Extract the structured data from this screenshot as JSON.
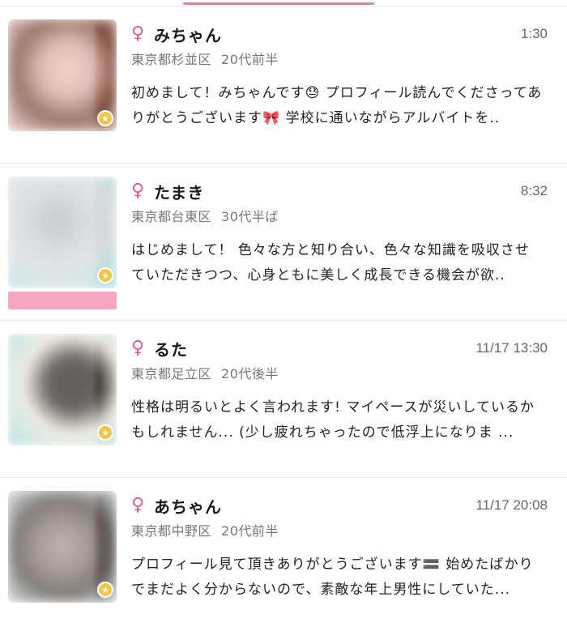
{
  "icons": {
    "gender": "female-icon",
    "badge": "star-badge-icon"
  },
  "colors": {
    "accent": "#f07aa0",
    "female": "#e85a8a",
    "badge": "#f4c542"
  },
  "users": [
    {
      "name": "みちゃん",
      "time": "1:30",
      "location": "東京都杉並区",
      "age": "20代前半",
      "message": "初めまして！みちゃんです😓 プロフィール読んでくださってありがとうございます🎀 学校に通いながらアルバイトを..",
      "photo_colors": [
        "#d9a8a0",
        "#7a4a3c",
        "#f0c9c8"
      ]
    },
    {
      "name": "たまき",
      "time": "8:32",
      "location": "東京都台東区",
      "age": "30代半ば",
      "message": "はじめまして！ 色々な方と知り合い、色々な知識を吸収させていただきつつ、心身ともに美しく成長できる機会が欲..",
      "photo_colors": [
        "#cfd4d6",
        "#b5b8ba",
        "#9fe0e3"
      ]
    },
    {
      "name": "るた",
      "time": "11/17 13:30",
      "location": "東京都足立区",
      "age": "20代後半",
      "message": "性格は明るいとよく言われます! マイペースが災いしているかもしれません... (少し疲れちゃったので低浮上になりま ...",
      "photo_colors": [
        "#e9e6d8",
        "#2b2624",
        "#9ed9de"
      ]
    },
    {
      "name": "あちゃん",
      "time": "11/17 20:08",
      "location": "東京都中野区",
      "age": "20代前半",
      "message": "プロフィール見て頂きありがとうございます🟰 始めたばかりでまだよく分からないので、素敵な年上男性にしていた...",
      "photo_colors": [
        "#a79c92",
        "#5b524d",
        "#c7dbe0"
      ]
    }
  ]
}
